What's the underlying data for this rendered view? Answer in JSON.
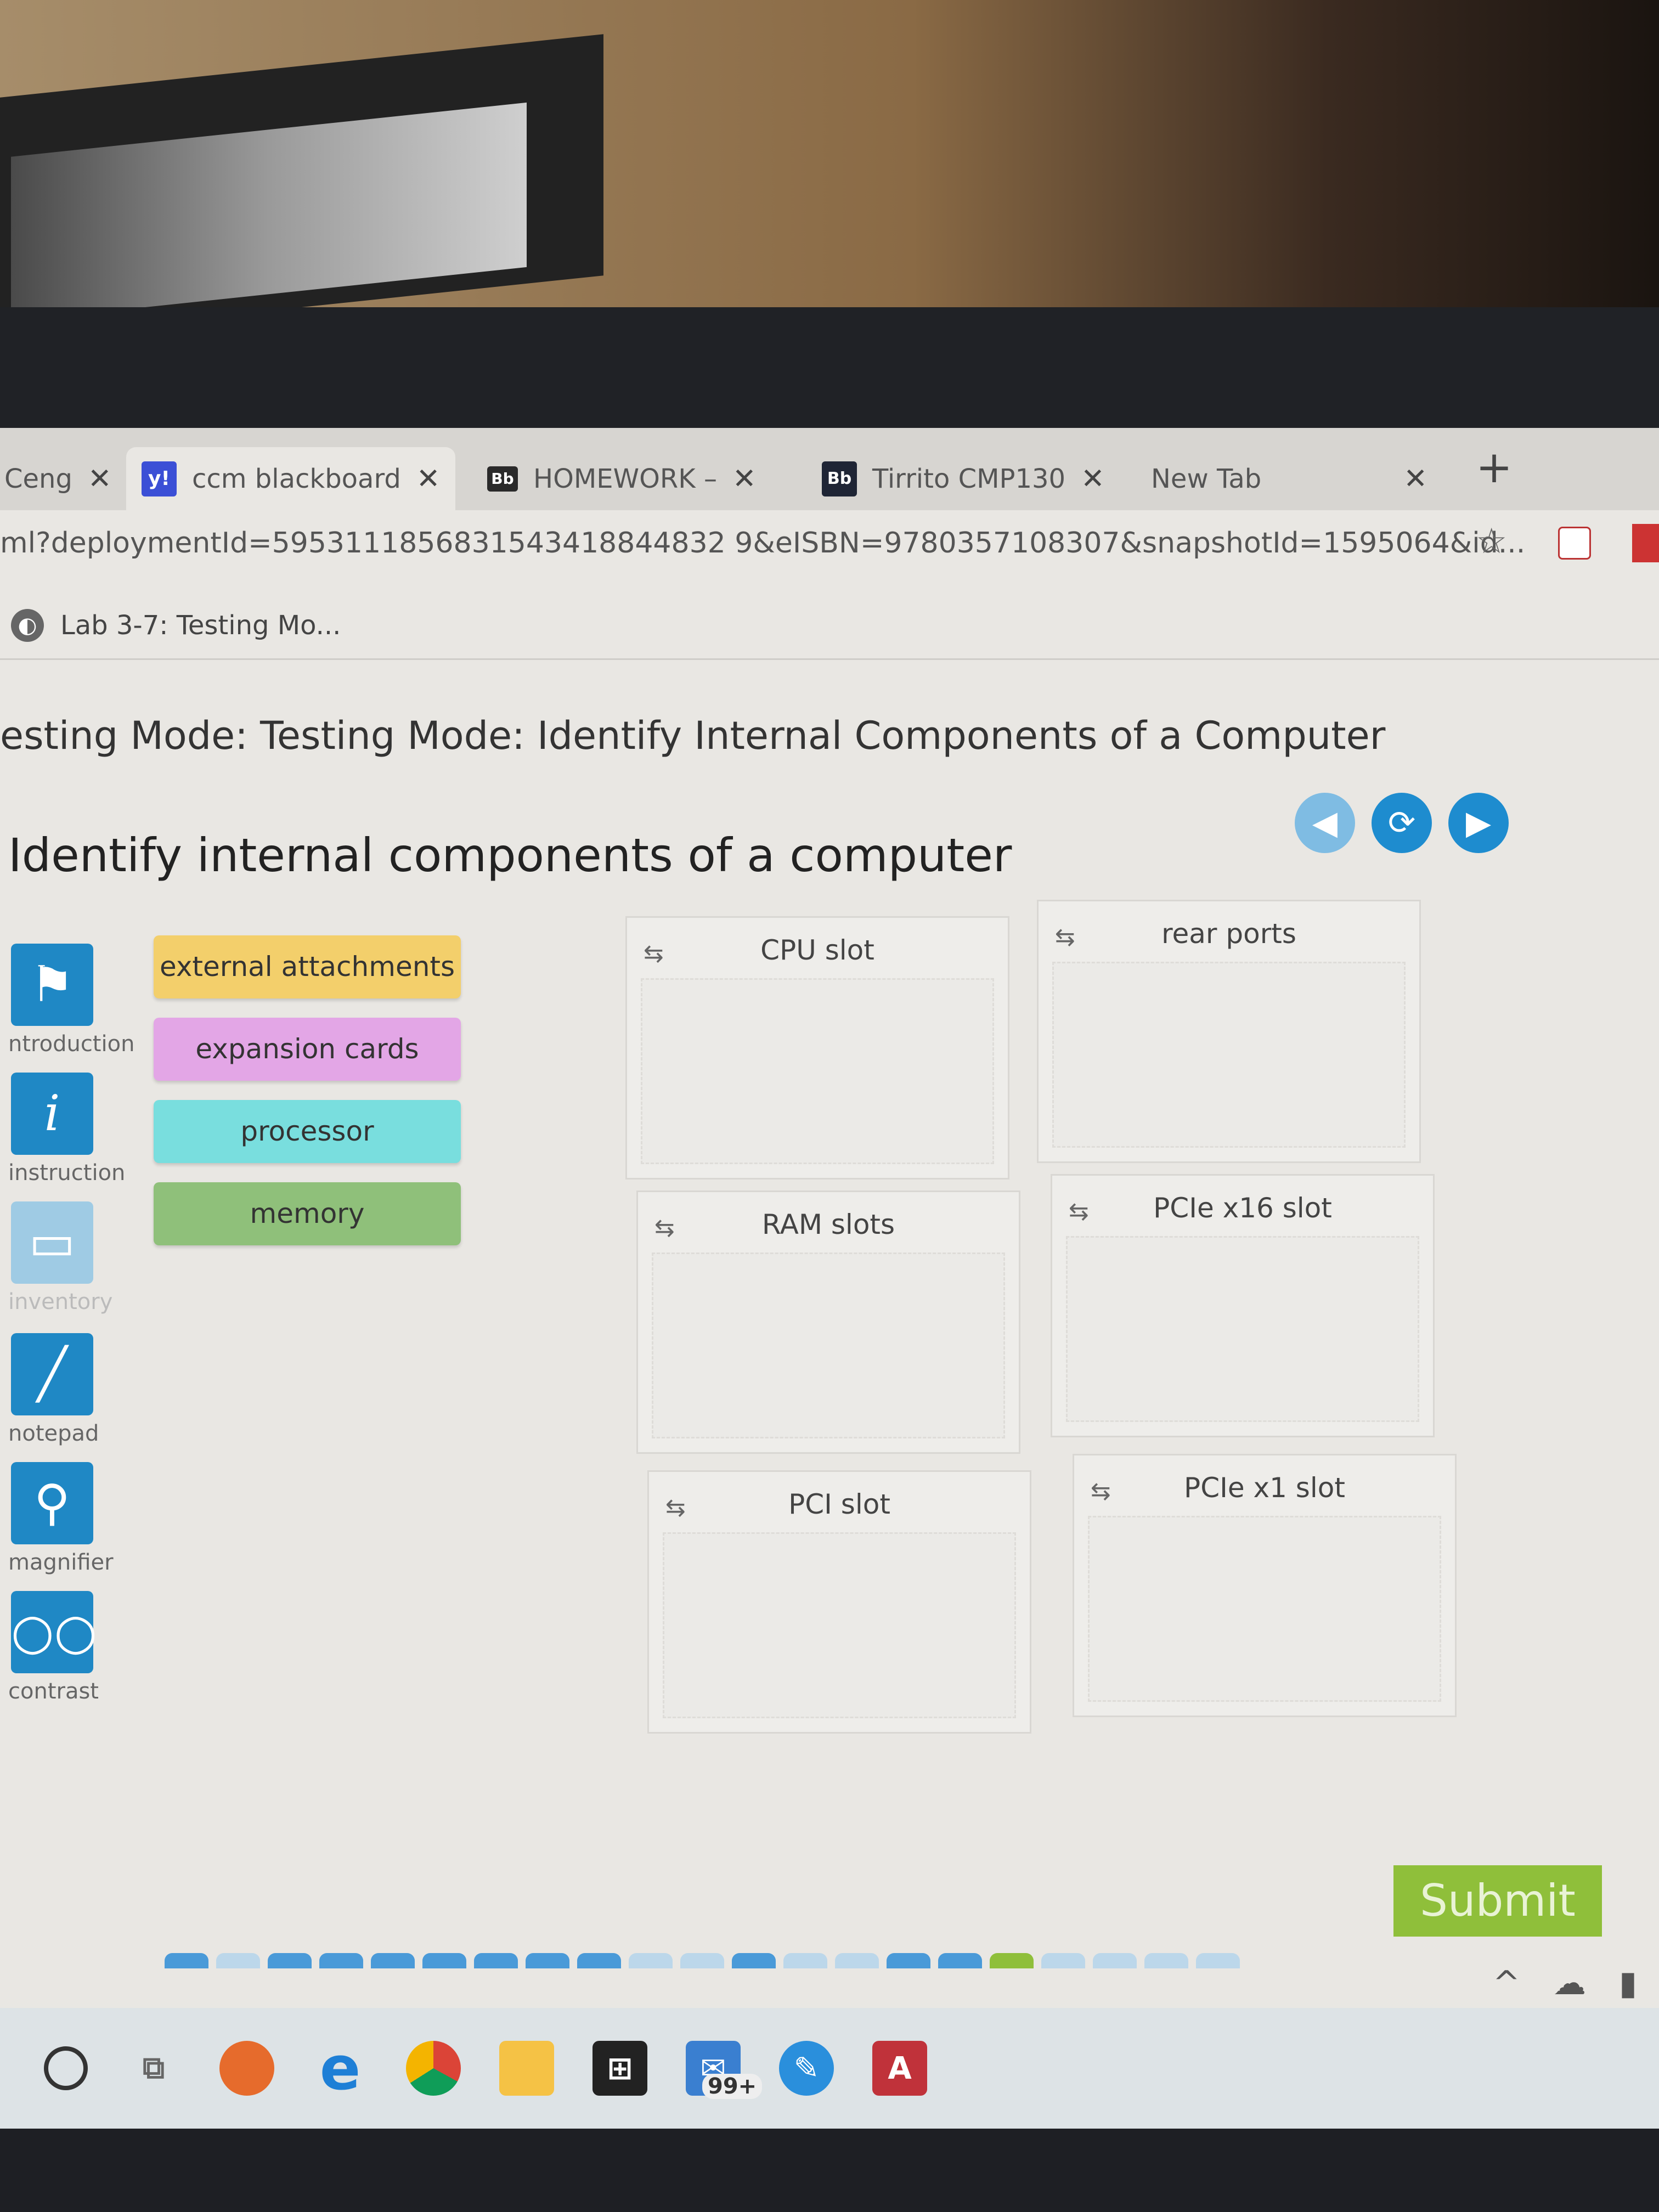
{
  "browser": {
    "tabs": [
      {
        "label": "Ceng",
        "icon": "cengage-icon"
      },
      {
        "label": "ccm blackboard",
        "icon": "yahoo-icon",
        "active": true
      },
      {
        "label": "HOMEWORK –",
        "icon": "blackboard-icon"
      },
      {
        "label": "Tirrito CMP130",
        "icon": "blackboard-icon"
      },
      {
        "label": "New Tab",
        "icon": ""
      }
    ],
    "url": "ml?deploymentId=5953111856831543418844832 9&eISBN=9780357108307&snapshotId=1595064&id...",
    "bookmark": "Lab 3-7: Testing Mo..."
  },
  "page": {
    "title": "esting Mode: Testing Mode: Identify Internal Components of a Computer",
    "heading": "Identify internal components of a computer",
    "sidebar": [
      {
        "label": "ntroduction",
        "icon": "flag-icon"
      },
      {
        "label": "instruction",
        "icon": "info-icon"
      },
      {
        "label": "inventory",
        "icon": "monitor-icon",
        "disabled": true
      },
      {
        "label": "notepad",
        "icon": "pencil-icon"
      },
      {
        "label": "magnifier",
        "icon": "magnifier-icon"
      },
      {
        "label": "contrast",
        "icon": "glasses-icon"
      }
    ],
    "tiles": [
      {
        "label": "external attachments",
        "color": "#f3cf6b"
      },
      {
        "label": "expansion cards",
        "color": "#e3a6e6"
      },
      {
        "label": "processor",
        "color": "#79dede"
      },
      {
        "label": "memory",
        "color": "#8fc07a"
      }
    ],
    "zones": [
      {
        "label": "CPU slot"
      },
      {
        "label": "rear ports"
      },
      {
        "label": "RAM slots"
      },
      {
        "label": "PCIe x16 slot"
      },
      {
        "label": "PCI slot"
      },
      {
        "label": "PCIe x1 slot"
      }
    ],
    "submit_label": "Submit"
  },
  "taskbar": {
    "mail_badge": "99+"
  },
  "colors": {
    "accent": "#1e8ccf",
    "submit": "#8fbf3a"
  }
}
